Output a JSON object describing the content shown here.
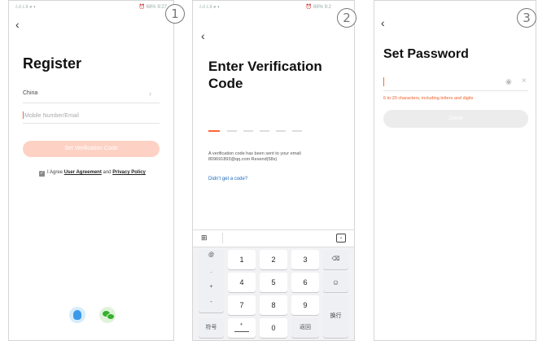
{
  "steps": [
    "1",
    "2",
    "3"
  ],
  "screen1": {
    "status_left": "ⅈ.ıl ⅈ.ıl ◕ ◐",
    "status_right": "⏰ 68% 9:27",
    "title": "Register",
    "country": "China",
    "input_placeholder": "Mobile Number/Email",
    "button": "Set Verification Code",
    "agree_prefix": "I Agree",
    "user_agreement": "User Agreement",
    "and": "and",
    "privacy_policy": "Privacy Policy",
    "accent": "#ff6633",
    "button_color": "#fdd2c4"
  },
  "screen2": {
    "status_left": "ⅈ.ıl ⅈ.ıl ◕ ◐",
    "status_right": "⏰ 68% 9:2",
    "title_line1": "Enter Verification",
    "title_line2": "Code",
    "sent_line1": "A verification code has been sent to your email",
    "sent_line2": "809691893@qq.com  Resend(58s)",
    "no_code": "Didn't get a code?",
    "keyboard": {
      "left_col": [
        "@",
        ".",
        "+",
        "-"
      ],
      "rows": [
        [
          "1",
          "2",
          "3"
        ],
        [
          "4",
          "5",
          "6"
        ],
        [
          "7",
          "8",
          "9"
        ]
      ],
      "bottom": {
        "symbol": "符号",
        "zero": "0",
        "back": "返回",
        "enter": "换行"
      }
    }
  },
  "screen3": {
    "title": "Set Password",
    "hint": "6 to 20 characters, including letters and digits",
    "button": "Done",
    "hint_color": "#f0602a"
  }
}
